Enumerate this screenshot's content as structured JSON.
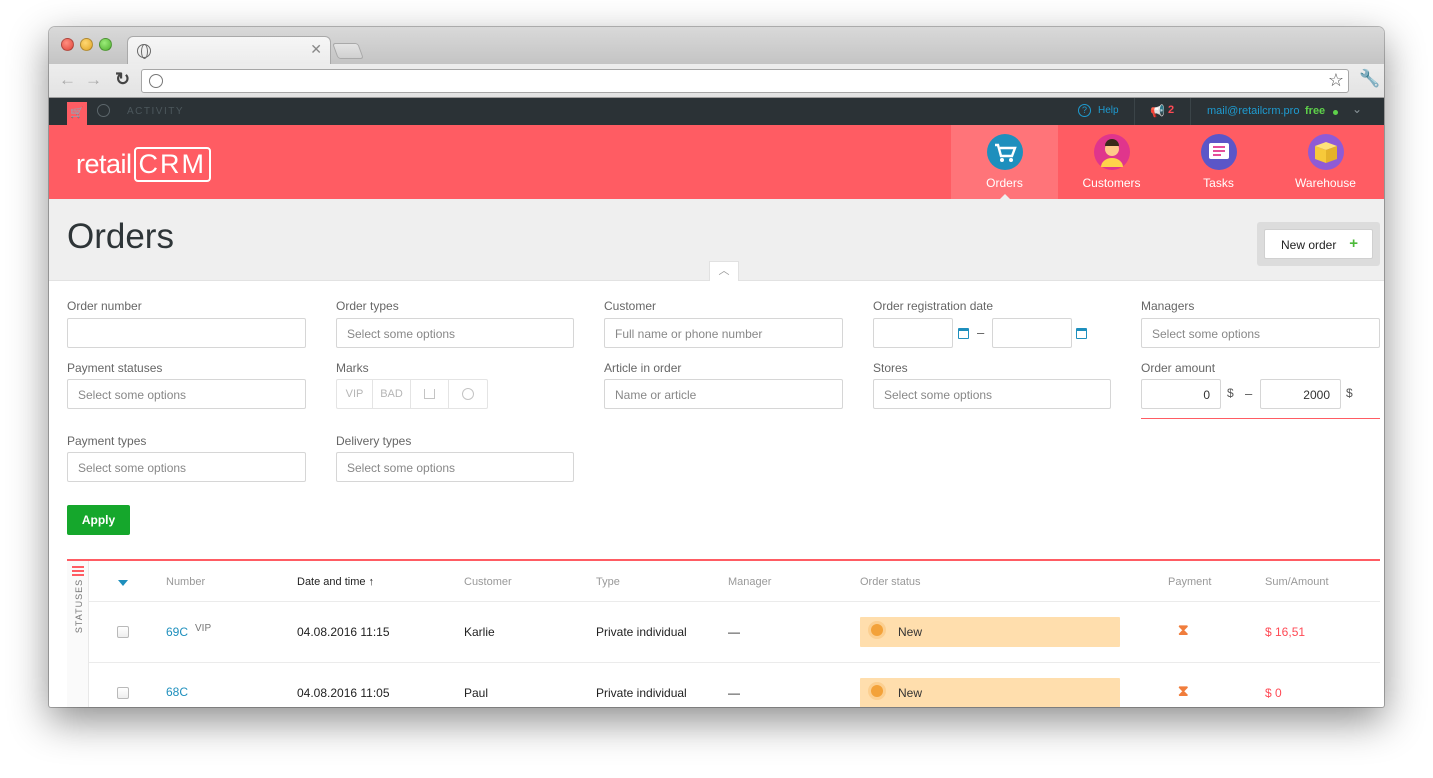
{
  "topbar": {
    "activity": "ACTIVITY",
    "help": "Help",
    "notifications_count": "2",
    "email": "mail@retailcrm.pro",
    "plan": "free"
  },
  "header": {
    "logo_text": "retail",
    "logo_crm": "CRM",
    "nav": [
      {
        "label": "Orders",
        "icon": "cart-icon",
        "color": "#1e8fbd"
      },
      {
        "label": "Customers",
        "icon": "person-icon",
        "color": "#e0358c"
      },
      {
        "label": "Tasks",
        "icon": "list-icon",
        "color": "#5b56c8"
      },
      {
        "label": "Warehouse",
        "icon": "box-icon",
        "color": "#8f5bd6"
      }
    ]
  },
  "page": {
    "title": "Orders",
    "new_order_label": "New order"
  },
  "filters": {
    "order_number": {
      "label": "Order number",
      "placeholder": ""
    },
    "order_types": {
      "label": "Order types",
      "placeholder": "Select some options"
    },
    "customer": {
      "label": "Customer",
      "placeholder": "Full name or phone number"
    },
    "registration_date": {
      "label": "Order registration date",
      "separator": "–"
    },
    "managers": {
      "label": "Managers",
      "placeholder": "Select some options"
    },
    "payment_statuses": {
      "label": "Payment statuses",
      "placeholder": "Select some options"
    },
    "marks": {
      "label": "Marks",
      "items": [
        "VIP",
        "BAD"
      ]
    },
    "article": {
      "label": "Article in order",
      "placeholder": "Name or article"
    },
    "stores": {
      "label": "Stores",
      "placeholder": "Select some options"
    },
    "order_amount": {
      "label": "Order amount",
      "min": "0",
      "max": "2000",
      "currency": "$",
      "separator": "–"
    },
    "payment_types": {
      "label": "Payment types",
      "placeholder": "Select some options"
    },
    "delivery_types": {
      "label": "Delivery types",
      "placeholder": "Select some options"
    },
    "apply_label": "Apply"
  },
  "table": {
    "statuses_label": "STATUSES",
    "columns": [
      "Number",
      "Date and time ↑",
      "Customer",
      "Type",
      "Manager",
      "Order status",
      "Payment",
      "Sum/Amount"
    ],
    "rows": [
      {
        "number": "69C",
        "mark": "VIP",
        "datetime": "04.08.2016 11:15",
        "customer": "Karlie",
        "type": "Private individual",
        "manager": "—",
        "status": "New",
        "sum": "$ 16,51"
      },
      {
        "number": "68C",
        "mark": "",
        "datetime": "04.08.2016 11:05",
        "customer": "Paul",
        "type": "Private individual",
        "manager": "—",
        "status": "New",
        "sum": "$ 0"
      }
    ]
  }
}
